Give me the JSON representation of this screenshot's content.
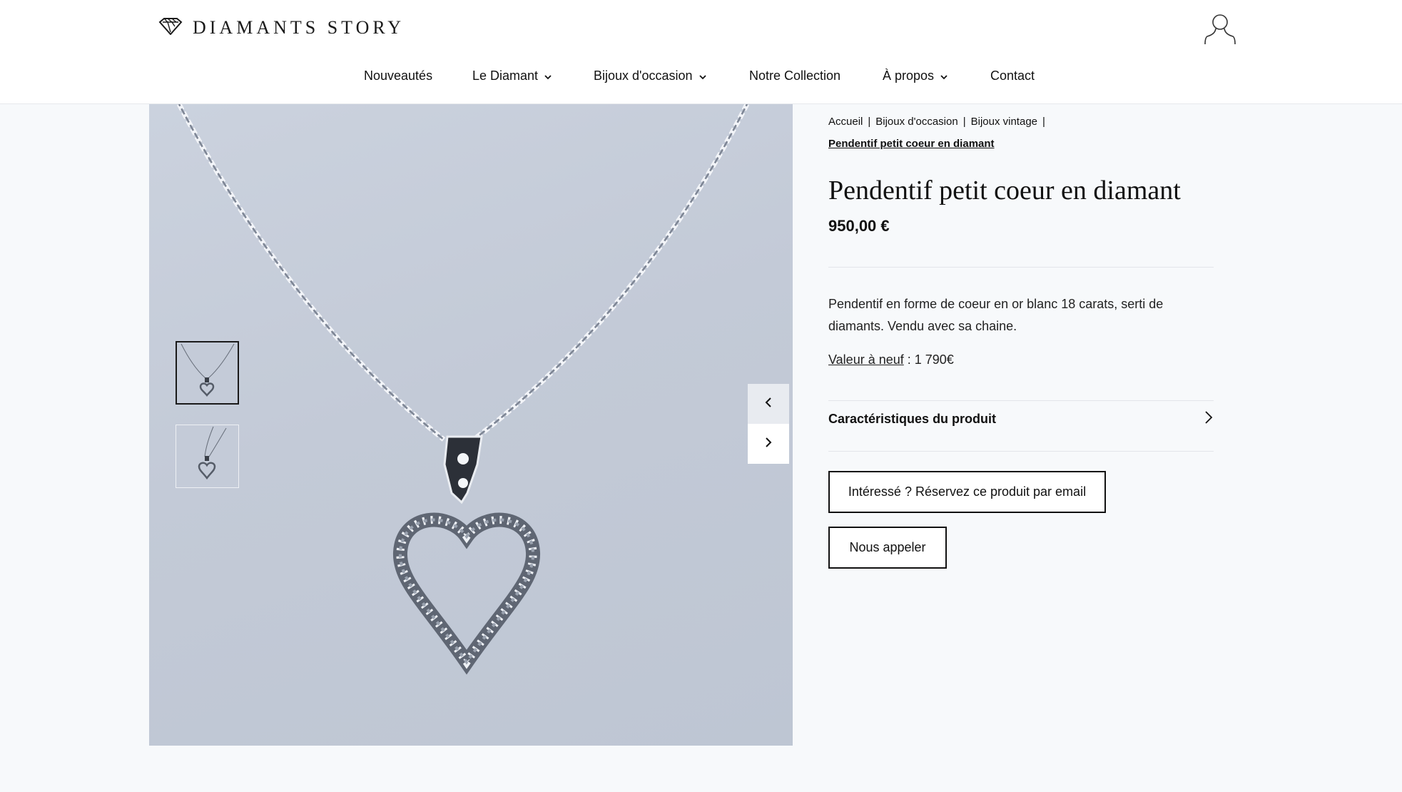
{
  "brand": {
    "name": "DIAMANTS STORY"
  },
  "nav": {
    "items": [
      {
        "label": "Nouveautés"
      },
      {
        "label": "Le Diamant"
      },
      {
        "label": "Bijoux d'occasion"
      },
      {
        "label": "Notre Collection"
      },
      {
        "label": "À propos"
      },
      {
        "label": "Contact"
      }
    ]
  },
  "breadcrumb": {
    "items": [
      "Accueil",
      "Bijoux d'occasion",
      "Bijoux vintage"
    ],
    "separator": "|",
    "current": "Pendentif petit coeur en diamant"
  },
  "product": {
    "title": "Pendentif petit coeur en diamant",
    "price": "950,00 €",
    "description": "Pendentif en forme de coeur en or blanc 18 carats, serti de diamants. Vendu avec sa chaine.",
    "value_link": "Valeur à neuf",
    "value_text": " : 1 790€",
    "specs_label": "Caractéristiques du produit",
    "reserve_button": "Intéressé ? Réservez ce produit par email",
    "call_button": "Nous appeler"
  },
  "gallery": {
    "thumbnail_count": 2,
    "active_thumbnail": 1
  },
  "icons": {
    "logo": "diamond-logo-icon",
    "user": "user-account-icon",
    "dropdown": "chevron-down-icon",
    "prev": "chevron-left-icon",
    "next": "chevron-right-icon",
    "specs": "chevron-right-icon"
  },
  "colors": {
    "header_bg": "#ffffff",
    "page_bg": "#f7f9fb",
    "photo_bg": "#c4cbd8",
    "text": "#111111"
  }
}
